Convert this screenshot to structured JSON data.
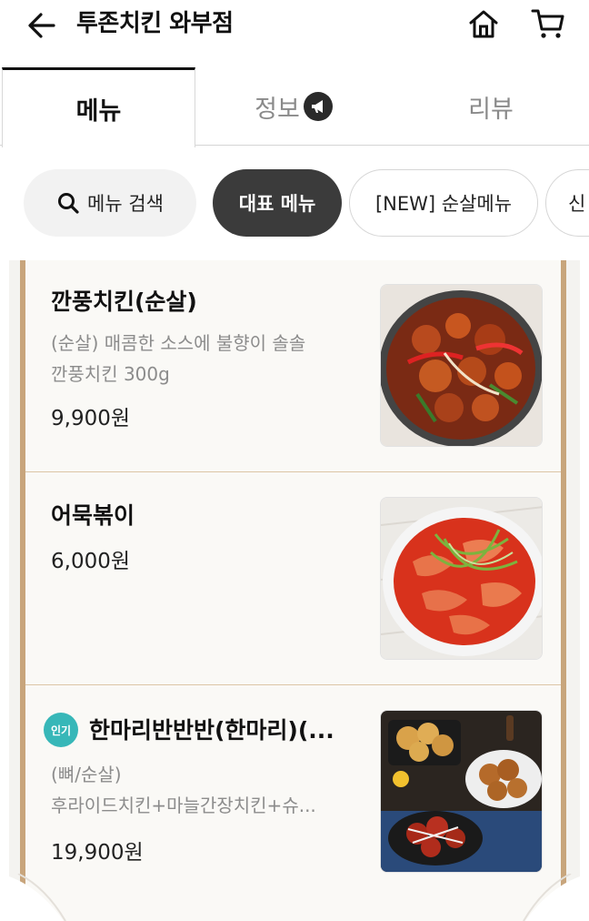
{
  "header": {
    "title": "투존치킨 와부점",
    "back_icon": "arrow-left-icon",
    "home_icon": "home-icon",
    "cart_icon": "cart-icon"
  },
  "tabs": [
    {
      "label": "메뉴",
      "active": true
    },
    {
      "label": "정보",
      "active": false,
      "badge_icon": "megaphone-icon"
    },
    {
      "label": "리뷰",
      "active": false
    }
  ],
  "chips": {
    "search_label": "메뉴 검색",
    "items": [
      "대표 메뉴",
      "[NEW] 순살메뉴",
      "신"
    ]
  },
  "menu_items": [
    {
      "name": "깐풍치킨(순살)",
      "desc_lines": [
        "(순살) 매콤한 소스에 불향이 솔솔",
        "깐풍치킨 300g"
      ],
      "price": "9,900원",
      "image_icon": "kkanpung-chicken-photo"
    },
    {
      "name": "어묵볶이",
      "desc_lines": [],
      "price": "6,000원",
      "image_icon": "eomuk-bokki-photo"
    },
    {
      "badge": "인기",
      "name": "한마리반반반(한마리)(...",
      "desc_lines": [
        "(뼈/순살)",
        "후라이드치킨+마늘간장치킨+슈..."
      ],
      "price": "19,900원",
      "image_icon": "half-half-chicken-photo"
    }
  ],
  "colors": {
    "frame": "#c8a57c",
    "active_chip": "#3b3b3b",
    "popular_badge": "#37b7b8"
  }
}
